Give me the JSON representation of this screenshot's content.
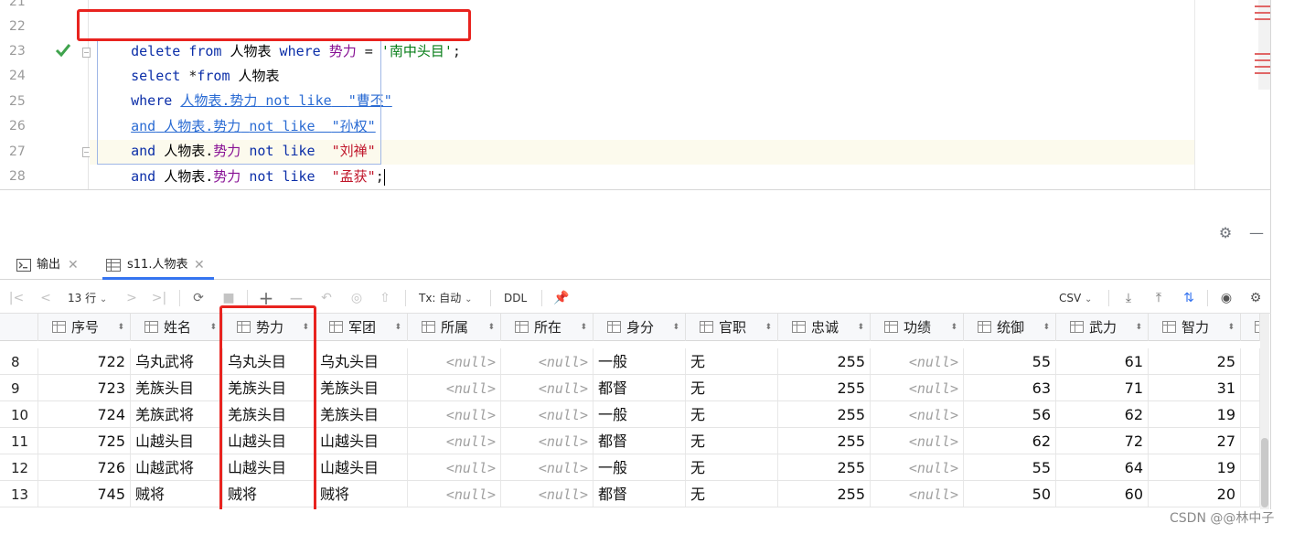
{
  "editor": {
    "line_numbers": [
      "21",
      "22",
      "23",
      "24",
      "25",
      "26",
      "27",
      "28"
    ],
    "lines": [
      {
        "kw1": "delete",
        "kw2": "from",
        "table": "人物表",
        "kw3": "where",
        "field": "势力",
        "op": "=",
        "value": "'南中头目'",
        "end": ";"
      },
      {
        "kw1": "select",
        "star": "*",
        "kw2": "from",
        "table": "人物表"
      },
      {
        "kw1": "where",
        "table": "人物表.",
        "field": "势力",
        "kw2": "not like",
        "value": "\"曹丕\""
      },
      {
        "kw1": "and",
        "table": "人物表.",
        "field": "势力",
        "kw2": "not like",
        "value": "\"孙权\""
      },
      {
        "kw1": "and",
        "table": "人物表.",
        "field": "势力",
        "kw2": "not like",
        "value": "\"刘禅\""
      },
      {
        "kw1": "and",
        "table": "人物表.",
        "field": "势力",
        "kw2": "not like",
        "value": "\"孟获\"",
        "end": ";"
      }
    ]
  },
  "tabs": [
    {
      "label": "输出",
      "icon": "console-icon"
    },
    {
      "label": "s11.人物表",
      "icon": "table-icon"
    }
  ],
  "toolbar": {
    "row_count": "13 行",
    "tx_mode": "Tx: 自动",
    "ddl": "DDL",
    "export_format": "CSV"
  },
  "grid": {
    "columns": [
      "序号",
      "姓名",
      "势力",
      "军团",
      "所属",
      "所在",
      "身分",
      "官职",
      "忠诚",
      "功绩",
      "统御",
      "武力",
      "智力"
    ],
    "rows": [
      {
        "rn": "8",
        "cells": [
          "722",
          "乌丸武将",
          "乌丸头目",
          "乌丸头目",
          "<null>",
          "<null>",
          "一般",
          "无",
          "255",
          "<null>",
          "55",
          "61",
          "25"
        ]
      },
      {
        "rn": "9",
        "cells": [
          "723",
          "羌族头目",
          "羌族头目",
          "羌族头目",
          "<null>",
          "<null>",
          "都督",
          "无",
          "255",
          "<null>",
          "63",
          "71",
          "31"
        ]
      },
      {
        "rn": "10",
        "cells": [
          "724",
          "羌族武将",
          "羌族头目",
          "羌族头目",
          "<null>",
          "<null>",
          "一般",
          "无",
          "255",
          "<null>",
          "56",
          "62",
          "19"
        ]
      },
      {
        "rn": "11",
        "cells": [
          "725",
          "山越头目",
          "山越头目",
          "山越头目",
          "<null>",
          "<null>",
          "都督",
          "无",
          "255",
          "<null>",
          "62",
          "72",
          "27"
        ]
      },
      {
        "rn": "12",
        "cells": [
          "726",
          "山越武将",
          "山越头目",
          "山越头目",
          "<null>",
          "<null>",
          "一般",
          "无",
          "255",
          "<null>",
          "55",
          "64",
          "19"
        ]
      },
      {
        "rn": "13",
        "cells": [
          "745",
          "贼将",
          "贼将",
          "贼将",
          "<null>",
          "<null>",
          "都督",
          "无",
          "255",
          "<null>",
          "50",
          "60",
          "20"
        ]
      }
    ]
  },
  "watermark": "CSDN @@林中子",
  "colors": {
    "highlight_red": "#e8231f",
    "keyword": "#0b2ea8",
    "field": "#871094",
    "string": "#067d17",
    "string_alt": "#c0162a"
  }
}
